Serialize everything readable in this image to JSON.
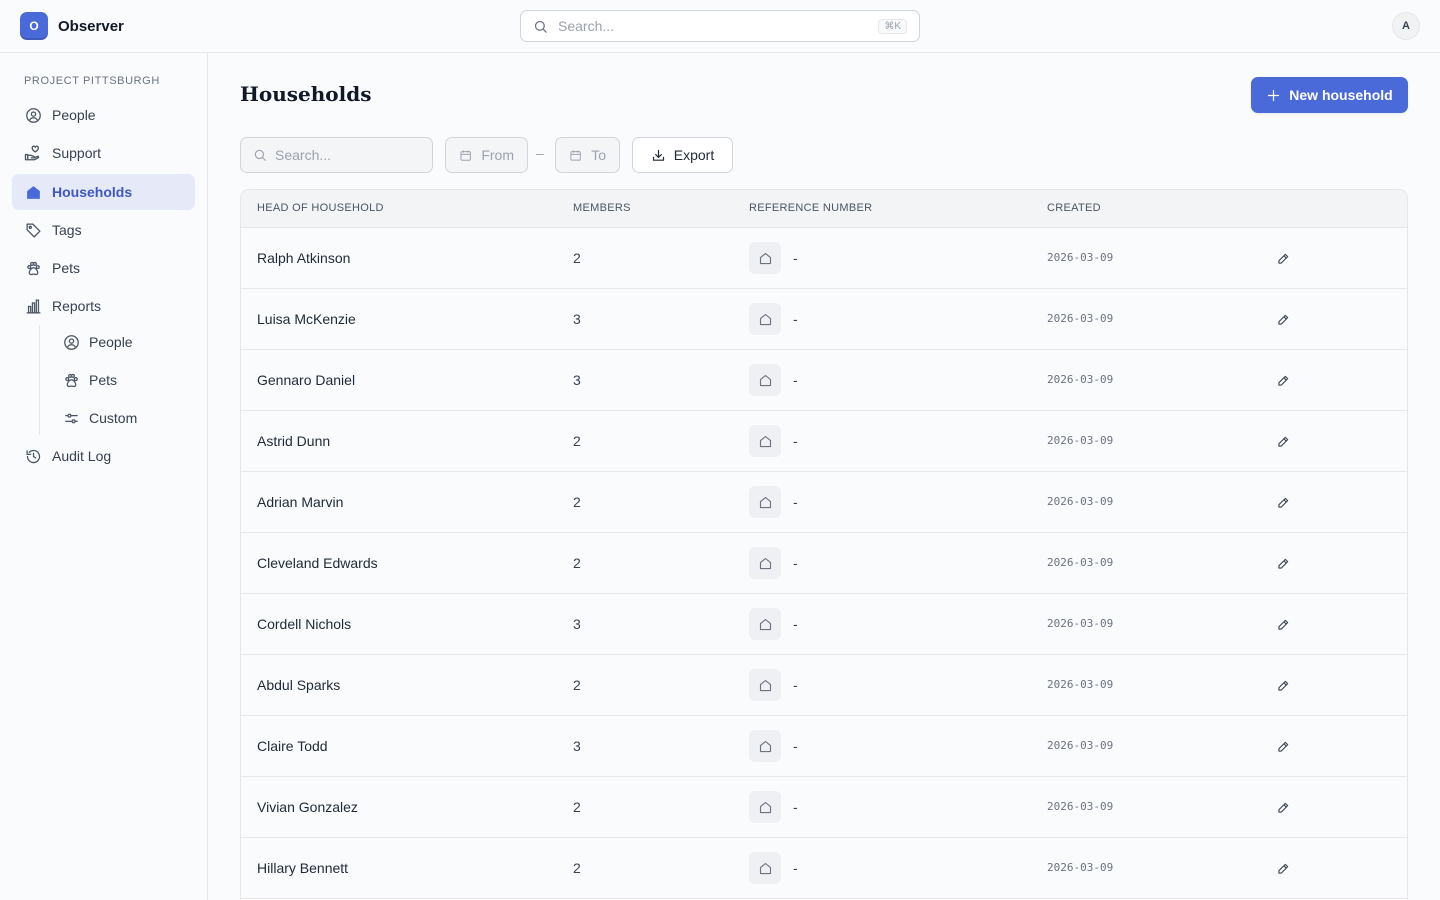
{
  "app": {
    "name": "Observer",
    "logo_letter": "O"
  },
  "global_search": {
    "placeholder": "Search...",
    "shortcut": "⌘K"
  },
  "user": {
    "initial": "A"
  },
  "sidebar": {
    "project_label": "PROJECT PITTSBURGH",
    "items": [
      {
        "label": "People",
        "icon": "user-circle-icon"
      },
      {
        "label": "Support",
        "icon": "hand-heart-icon"
      },
      {
        "label": "Households",
        "icon": "home-icon",
        "active": true
      },
      {
        "label": "Tags",
        "icon": "tag-icon"
      },
      {
        "label": "Pets",
        "icon": "paw-icon"
      },
      {
        "label": "Reports",
        "icon": "bar-chart-icon"
      }
    ],
    "report_items": [
      {
        "label": "People",
        "icon": "user-circle-icon"
      },
      {
        "label": "Pets",
        "icon": "paw-icon"
      },
      {
        "label": "Custom",
        "icon": "sliders-icon"
      }
    ],
    "audit_log": {
      "label": "Audit Log",
      "icon": "history-icon"
    }
  },
  "page": {
    "title": "Households",
    "new_button": "New household"
  },
  "filters": {
    "search_placeholder": "Search...",
    "from_label": "From",
    "separator": "–",
    "to_label": "To",
    "export_label": "Export"
  },
  "table": {
    "columns": [
      "HEAD OF HOUSEHOLD",
      "MEMBERS",
      "REFERENCE NUMBER",
      "CREATED"
    ],
    "rows": [
      {
        "name": "Ralph Atkinson",
        "members": "2",
        "reference": "-",
        "created": "2026-03-09"
      },
      {
        "name": "Luisa McKenzie",
        "members": "3",
        "reference": "-",
        "created": "2026-03-09"
      },
      {
        "name": "Gennaro Daniel",
        "members": "3",
        "reference": "-",
        "created": "2026-03-09"
      },
      {
        "name": "Astrid Dunn",
        "members": "2",
        "reference": "-",
        "created": "2026-03-09"
      },
      {
        "name": "Adrian Marvin",
        "members": "2",
        "reference": "-",
        "created": "2026-03-09"
      },
      {
        "name": "Cleveland Edwards",
        "members": "2",
        "reference": "-",
        "created": "2026-03-09"
      },
      {
        "name": "Cordell Nichols",
        "members": "3",
        "reference": "-",
        "created": "2026-03-09"
      },
      {
        "name": "Abdul Sparks",
        "members": "2",
        "reference": "-",
        "created": "2026-03-09"
      },
      {
        "name": "Claire Todd",
        "members": "3",
        "reference": "-",
        "created": "2026-03-09"
      },
      {
        "name": "Vivian Gonzalez",
        "members": "2",
        "reference": "-",
        "created": "2026-03-09"
      },
      {
        "name": "Hillary Bennett",
        "members": "2",
        "reference": "-",
        "created": "2026-03-09"
      }
    ]
  },
  "colors": {
    "accent": "#4a6ad9",
    "active_bg": "#e5e9f8",
    "border": "#e5e7eb"
  }
}
